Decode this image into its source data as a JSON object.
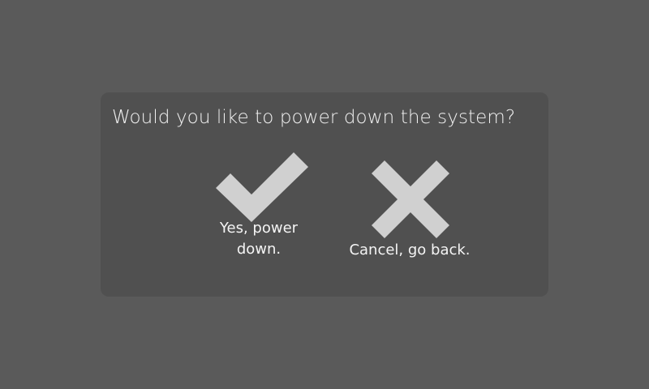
{
  "dialog": {
    "question": "Would you like to power down the system?",
    "confirm": {
      "label_line1": "Yes, power",
      "label_line2": "down.",
      "icon": "check-icon"
    },
    "cancel": {
      "label": "Cancel, go back.",
      "icon": "x-icon"
    }
  },
  "colors": {
    "background": "#5a5a5a",
    "dialog": "#505050",
    "icon": "#d0d0d0",
    "text": "#f2f2f2"
  }
}
